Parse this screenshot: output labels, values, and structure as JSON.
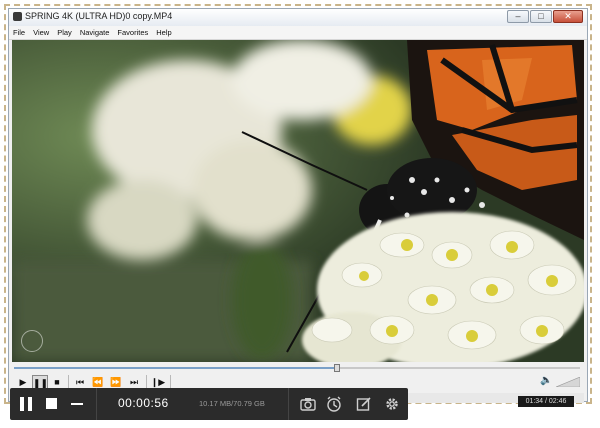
{
  "window": {
    "title": "SPRING 4K (ULTRA HD)0 copy.MP4",
    "controls": [
      "–",
      "□",
      "✕"
    ]
  },
  "menu": [
    "File",
    "View",
    "Play",
    "Navigate",
    "Favorites",
    "Help"
  ],
  "playback": {
    "progress": 0.57,
    "time_display": "01:34 / 02:46"
  },
  "recorder": {
    "timer": "00:00:56",
    "file_size": "10.17 MB/70.79 GB"
  },
  "colors": {
    "recorder_bg": "#2b2b2b",
    "accent": "#7aa0c8"
  }
}
